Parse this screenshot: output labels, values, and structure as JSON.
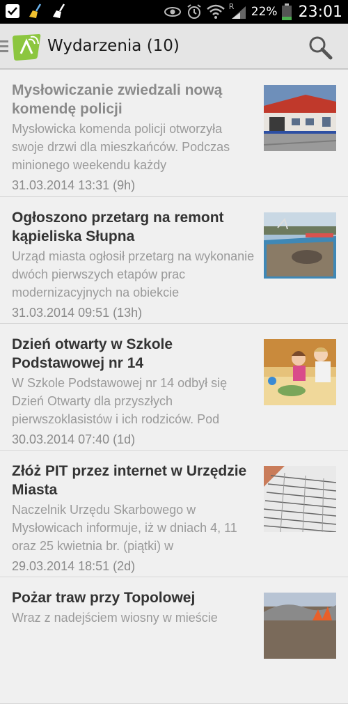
{
  "status_bar": {
    "battery_percent": "22%",
    "time": "23:01",
    "network_roaming": "R"
  },
  "action_bar": {
    "title": "Wydarzenia (10)"
  },
  "news": [
    {
      "title": "Mysłowiczanie zwiedzali nową komendę policji",
      "description": "Mysłowicka komenda policji otworzyła swoje drzwi dla mieszkańców. Podczas minionego weekendu każdy",
      "date": "31.03.2014 13:31 (9h)",
      "read": true
    },
    {
      "title": "Ogłoszono przetarg na remont kąpieliska Słupna",
      "description": "Urząd miasta ogłosił przetarg na wykonanie dwóch pierwszych etapów prac modernizacyjnych na obiekcie",
      "date": "31.03.2014 09:51 (13h)",
      "read": false
    },
    {
      "title": "Dzień otwarty w Szkole Podstawowej nr 14",
      "description": "W Szkole Podstawowej nr 14 odbył się Dzień Otwarty dla przyszłych pierwszoklasistów i ich rodziców. Pod",
      "date": "30.03.2014 07:40 (1d)",
      "read": false
    },
    {
      "title": "Złóż PIT przez internet w Urzędzie Miasta",
      "description": "Naczelnik Urzędu Skarbowego w Mysłowicach informuje, iż w dniach 4, 11 oraz 25 kwietnia br. (piątki) w",
      "date": "29.03.2014 18:51 (2d)",
      "read": false
    },
    {
      "title": "Pożar traw przy Topolowej",
      "description": "Wraz z nadejściem wiosny w mieście",
      "date": "",
      "read": false
    }
  ],
  "colors": {
    "action_bar": "#e5e5e5",
    "background": "#f0f0f0",
    "logo_green": "#8cc63f",
    "title_unread": "#333333",
    "title_read": "#8a8a8a"
  }
}
